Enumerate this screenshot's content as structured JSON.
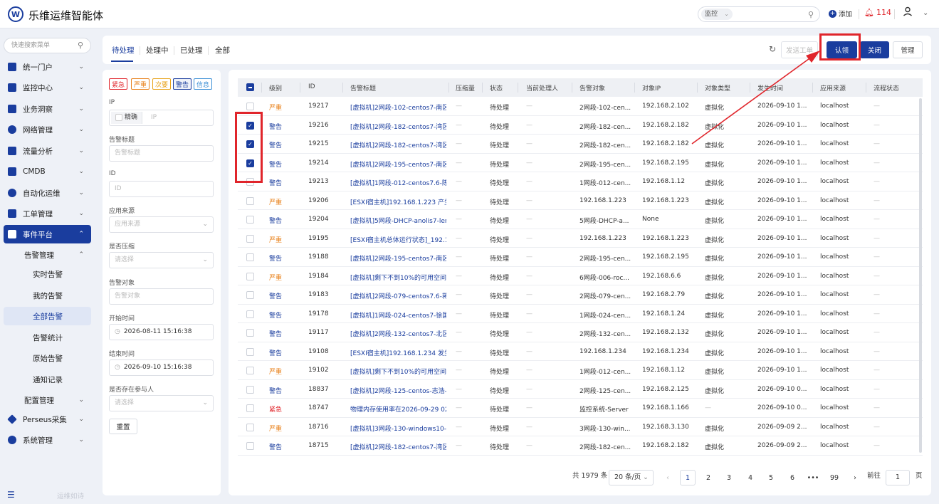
{
  "app": {
    "logo": "W",
    "title": "乐维运维智能体"
  },
  "topbar": {
    "search_select": "监控",
    "add_label": "添加",
    "alert_count": "114"
  },
  "sidebar": {
    "search_placeholder": "快速搜索菜单",
    "items": [
      {
        "label": "统一门户"
      },
      {
        "label": "监控中心"
      },
      {
        "label": "业务洞察"
      },
      {
        "label": "网络管理"
      },
      {
        "label": "流量分析"
      },
      {
        "label": "CMDB"
      },
      {
        "label": "自动化运维"
      },
      {
        "label": "工单管理"
      },
      {
        "label": "事件平台"
      },
      {
        "label": "Perseus采集"
      },
      {
        "label": "系统管理"
      }
    ],
    "alert_mgmt": "告警管理",
    "sub": [
      {
        "label": "实时告警"
      },
      {
        "label": "我的告警"
      },
      {
        "label": "全部告警"
      },
      {
        "label": "告警统计"
      },
      {
        "label": "原始告警"
      },
      {
        "label": "通知记录"
      }
    ],
    "config_mgmt": "配置管理",
    "footer_text": "运维如诗"
  },
  "tabs": [
    {
      "label": "待处理"
    },
    {
      "label": "处理中"
    },
    {
      "label": "已处理"
    },
    {
      "label": "全部"
    }
  ],
  "actions": {
    "dispatch": "发送工单",
    "claim": "认领",
    "close": "关闭",
    "manage": "管理"
  },
  "filters": {
    "levels": [
      {
        "label": "紧急",
        "color": "#e0252b"
      },
      {
        "label": "严重",
        "color": "#e8801a"
      },
      {
        "label": "次要",
        "color": "#e8a31a"
      },
      {
        "label": "警告",
        "color": "#1a3d9e"
      },
      {
        "label": "信息",
        "color": "#3b8fd6"
      }
    ],
    "ip_label": "IP",
    "precise_label": "精确",
    "ip_placeholder": "IP",
    "title_label": "告警标题",
    "title_placeholder": "告警标题",
    "id_label": "ID",
    "id_placeholder": "ID",
    "source_label": "应用来源",
    "source_placeholder": "应用来源",
    "compress_label": "是否压缩",
    "compress_placeholder": "请选择",
    "target_label": "告警对象",
    "target_placeholder": "告警对象",
    "start_label": "开始时间",
    "start_value": "2026-08-11 15:16:38",
    "end_label": "结束时间",
    "end_value": "2026-09-10 15:16:38",
    "participant_label": "是否存在参与人",
    "participant_placeholder": "请选择",
    "reset": "重置"
  },
  "table": {
    "columns": [
      "级别",
      "ID",
      "告警标题",
      "压缩量",
      "状态",
      "当前处理人",
      "告警对象",
      "对象IP",
      "对象类型",
      "发生时间",
      "应用来源",
      "流程状态"
    ],
    "dash": "—",
    "rows": [
      {
        "level": "严重",
        "id": "19217",
        "title": "[虚拟机]2网段-102-centos7-南区-",
        "status": "待处理",
        "target": "2网段-102-cen...",
        "ip": "192.168.2.102",
        "type": "虚拟化",
        "time": "2026-09-10 1...",
        "source": "localhost",
        "checked": false
      },
      {
        "level": "警告",
        "id": "19216",
        "title": "[虚拟机]2网段-182-centos7-湾区-",
        "status": "待处理",
        "target": "2网段-182-cen...",
        "ip": "192.168.2.182",
        "type": "虚拟化",
        "time": "2026-09-10 1...",
        "source": "localhost",
        "checked": true
      },
      {
        "level": "警告",
        "id": "19215",
        "title": "[虚拟机]2网段-182-centos7-湾区-",
        "status": "待处理",
        "target": "2网段-182-cen...",
        "ip": "192.168.2.182",
        "type": "虚拟化",
        "time": "2026-09-10 1...",
        "source": "localhost",
        "checked": true
      },
      {
        "level": "警告",
        "id": "19214",
        "title": "[虚拟机]2网段-195-centos7-南区-",
        "status": "待处理",
        "target": "2网段-195-cen...",
        "ip": "192.168.2.195",
        "type": "虚拟化",
        "time": "2026-09-10 1...",
        "source": "localhost",
        "checked": true
      },
      {
        "level": "警告",
        "id": "19213",
        "title": "[虚拟机]1网段-012-centos7.6-陈金",
        "status": "待处理",
        "target": "1网段-012-cen...",
        "ip": "192.168.1.12",
        "type": "虚拟化",
        "time": "2026-09-10 1...",
        "source": "localhost",
        "checked": false
      },
      {
        "level": "严重",
        "id": "19206",
        "title": "[ESXI宿主机]192.168.1.223 产生严",
        "status": "待处理",
        "target": "192.168.1.223",
        "ip": "192.168.1.223",
        "type": "虚拟化",
        "time": "2026-09-10 1...",
        "source": "localhost",
        "checked": false
      },
      {
        "level": "警告",
        "id": "19204",
        "title": "[虚拟机]5网段-DHCP-anolis7-lerw",
        "status": "待处理",
        "target": "5网段-DHCP-a...",
        "ip": "None",
        "type": "虚拟化",
        "time": "2026-09-10 1...",
        "source": "localhost",
        "checked": false
      },
      {
        "level": "严重",
        "id": "19195",
        "title": "[ESXI宿主机总体运行状态]_192.168",
        "status": "待处理",
        "target": "192.168.1.223",
        "ip": "192.168.1.223",
        "type": "虚拟化",
        "time": "2026-09-10 1...",
        "source": "localhost",
        "checked": false
      },
      {
        "level": "警告",
        "id": "19188",
        "title": "[虚拟机]2网段-195-centos7-南区-",
        "status": "待处理",
        "target": "2网段-195-cen...",
        "ip": "192.168.2.195",
        "type": "虚拟化",
        "time": "2026-09-10 1...",
        "source": "localhost",
        "checked": false
      },
      {
        "level": "严重",
        "id": "19184",
        "title": "[虚拟机]剩下不到10%的可用空间/",
        "status": "待处理",
        "target": "6网段-006-roc...",
        "ip": "192.168.6.6",
        "type": "虚拟化",
        "time": "2026-09-10 1...",
        "source": "localhost",
        "checked": false
      },
      {
        "level": "警告",
        "id": "19183",
        "title": "[虚拟机]2网段-079-centos7.6-蒋涛",
        "status": "待处理",
        "target": "2网段-079-cen...",
        "ip": "192.168.2.79",
        "type": "虚拟化",
        "time": "2026-09-10 1...",
        "source": "localhost",
        "checked": false
      },
      {
        "level": "警告",
        "id": "19178",
        "title": "[虚拟机]1网段-024-centos7-徐国F",
        "status": "待处理",
        "target": "1网段-024-cen...",
        "ip": "192.168.1.24",
        "type": "虚拟化",
        "time": "2026-09-10 1...",
        "source": "localhost",
        "checked": false
      },
      {
        "level": "警告",
        "id": "19117",
        "title": "[虚拟机]2网段-132-centos7-北区-",
        "status": "待处理",
        "target": "2网段-132-cen...",
        "ip": "192.168.2.132",
        "type": "虚拟化",
        "time": "2026-09-10 1...",
        "source": "localhost",
        "checked": false
      },
      {
        "level": "警告",
        "id": "19108",
        "title": "[ESXI宿主机]192.168.1.234 发生警",
        "status": "待处理",
        "target": "192.168.1.234",
        "ip": "192.168.1.234",
        "type": "虚拟化",
        "time": "2026-09-10 1...",
        "source": "localhost",
        "checked": false
      },
      {
        "level": "严重",
        "id": "19102",
        "title": "[虚拟机]剩下不到10%的可用空间/c",
        "status": "待处理",
        "target": "1网段-012-cen...",
        "ip": "192.168.1.12",
        "type": "虚拟化",
        "time": "2026-09-10 1...",
        "source": "localhost",
        "checked": false
      },
      {
        "level": "警告",
        "id": "18837",
        "title": "[虚拟机]2网段-125-centos-志浩-项",
        "status": "待处理",
        "target": "2网段-125-cen...",
        "ip": "192.168.2.125",
        "type": "虚拟化",
        "time": "2026-09-10 0...",
        "source": "localhost",
        "checked": false
      },
      {
        "level": "紧急",
        "id": "18747",
        "title": "物理内存使用率在2026-09-29 02:3",
        "status": "待处理",
        "target": "监控系统-Server",
        "ip": "192.168.1.166",
        "type": "—",
        "time": "2026-09-10 0...",
        "source": "localhost",
        "checked": false
      },
      {
        "level": "严重",
        "id": "18716",
        "title": "[虚拟机]3网段-130-windows10-乐",
        "status": "待处理",
        "target": "3网段-130-win...",
        "ip": "192.168.3.130",
        "type": "虚拟化",
        "time": "2026-09-09 2...",
        "source": "localhost",
        "checked": false
      },
      {
        "level": "警告",
        "id": "18715",
        "title": "[虚拟机]2网段-182-centos7-湾区-",
        "status": "待处理",
        "target": "2网段-182-cen...",
        "ip": "192.168.2.182",
        "type": "虚拟化",
        "time": "2026-09-09 2...",
        "source": "localhost",
        "checked": false
      }
    ]
  },
  "level_colors": {
    "紧急": "#e0252b",
    "严重": "#e8801a",
    "警告": "#1a3d9e"
  },
  "pagination": {
    "total": "共 1979 条",
    "page_size": "20 条/页",
    "pages": [
      "1",
      "2",
      "3",
      "4",
      "5",
      "6",
      "•••",
      "99"
    ],
    "goto_label": "前往",
    "goto_value": "1",
    "page_suffix": "页"
  }
}
